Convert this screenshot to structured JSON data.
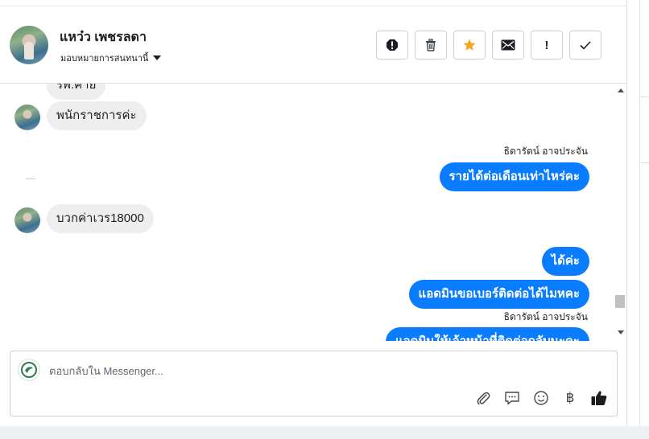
{
  "header": {
    "contact_name": "แหว๋ว เพชรลดา",
    "assign_label": "มอบหมายการสนทนานี้",
    "actions": [
      {
        "name": "spam-button",
        "icon": "alert-circle-icon"
      },
      {
        "name": "delete-button",
        "icon": "trash-icon"
      },
      {
        "name": "star-button",
        "icon": "star-icon",
        "color": "#f5a623"
      },
      {
        "name": "mark-unread-button",
        "icon": "envelope-icon"
      },
      {
        "name": "follow-up-button",
        "glyph": "!"
      },
      {
        "name": "mark-done-button",
        "icon": "check-icon"
      }
    ]
  },
  "thread": {
    "messages": [
      {
        "direction": "in",
        "text": "รพ.ค่าย",
        "partial": true
      },
      {
        "direction": "in",
        "text": "พนักราชการค่ะ"
      },
      {
        "direction": "out",
        "sender": "ธิดารัตน์ อาจประจัน",
        "text": "รายได้ต่อเดือนเท่าไหร่คะ"
      },
      {
        "direction": "in",
        "text": "บวกค่าเวร18000"
      },
      {
        "direction": "out",
        "text": "ได้ค่ะ"
      },
      {
        "direction": "out",
        "text": "แอดมินขอเบอร์ติดต่อได้ไมหคะ"
      },
      {
        "direction": "out",
        "sender": "ธิดารัตน์ อาจประจัน",
        "text": "แอดมินให้เจ้าหน้าที่ติดต่อกลับนะคะ",
        "partial": true
      }
    ]
  },
  "composer": {
    "placeholder": "ตอบกลับใน Messenger...",
    "value": "",
    "tools": [
      "attach-icon",
      "saved-replies-icon",
      "emoji-icon",
      "baht-icon",
      "thumbs-up-icon"
    ],
    "baht_glyph": "฿"
  },
  "colors": {
    "outgoing_bubble": "#0a7cff",
    "incoming_bubble": "#eeeeee",
    "star": "#f5a623"
  }
}
